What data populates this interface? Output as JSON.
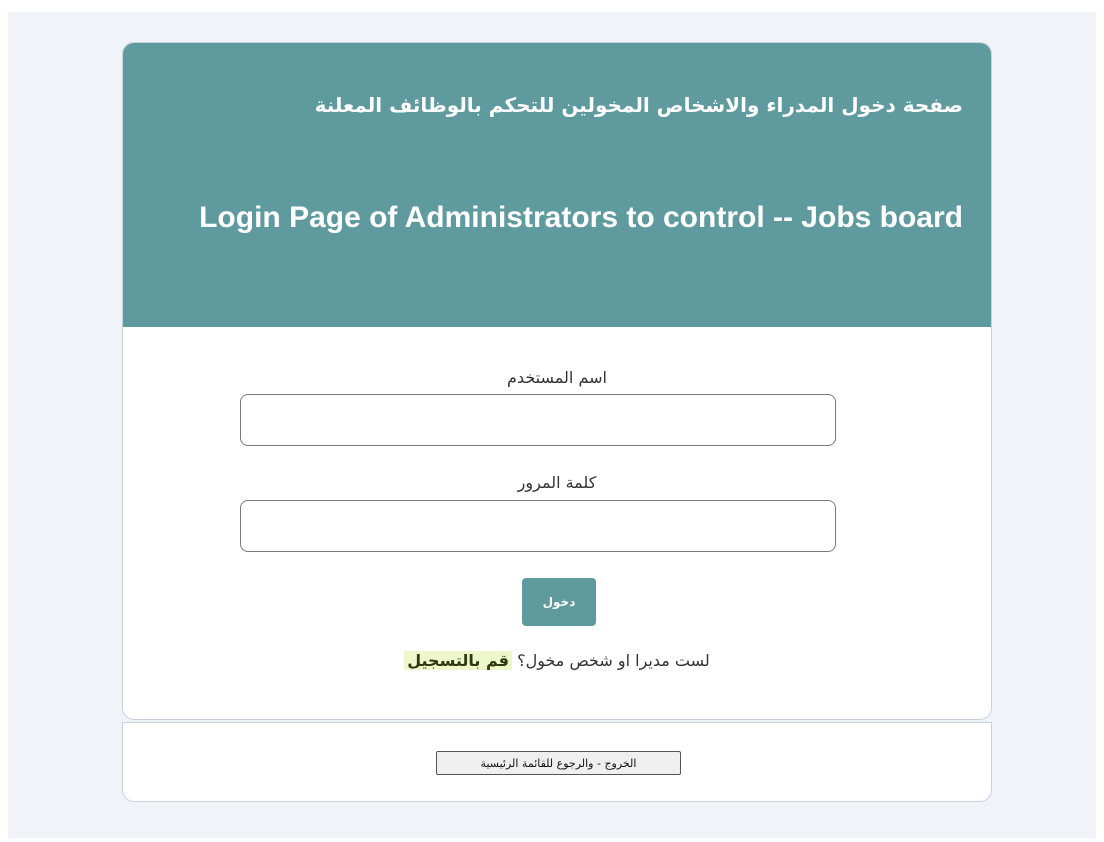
{
  "header": {
    "title_ar": "صفحة دخول المدراء والاشخاص المخولين للتحكم بالوظائف المعلنة",
    "title_en": "Login Page of Administrators to control -- Jobs board"
  },
  "form": {
    "username_label": "اسم المستخدم",
    "username_value": "",
    "password_label": "كلمة المرور",
    "password_value": "",
    "login_button": "دخول"
  },
  "register": {
    "prompt": "لست مديرا او شخص مخول؟ ",
    "link": "قم بالتسجيل"
  },
  "footer": {
    "exit_button": "الخروج - والرجوع للقائمة الرئيسية"
  },
  "colors": {
    "header_bg": "#5f9b9e",
    "button_bg": "#5f9b9e",
    "page_bg": "#f0f4f9"
  }
}
